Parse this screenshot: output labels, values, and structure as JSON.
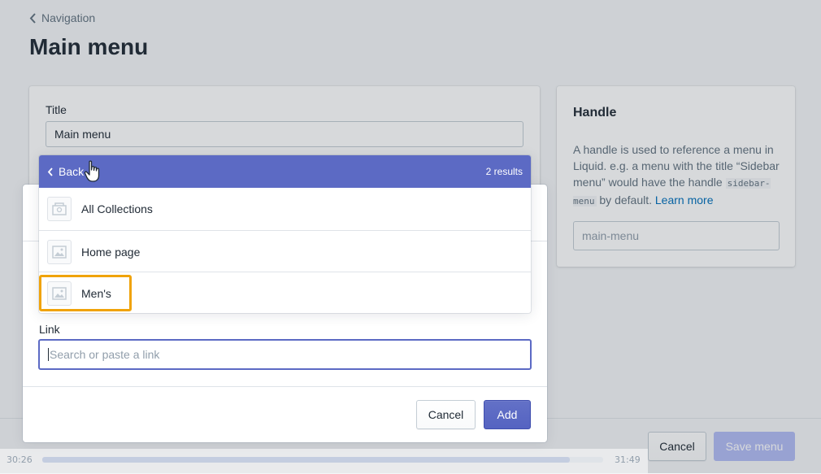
{
  "breadcrumb": {
    "label": "Navigation"
  },
  "page": {
    "title": "Main menu"
  },
  "menu_card": {
    "title_label": "Title",
    "title_value": "Main menu"
  },
  "handle_card": {
    "heading": "Handle",
    "text_1": "A handle is used to reference a menu in Liquid. e.g. a menu with the title “Sidebar menu” would have the handle ",
    "code": "sidebar-menu",
    "text_2": " by default. ",
    "learn_more": "Learn more",
    "input_value": "main-menu"
  },
  "footer": {
    "cancel_label": "Cancel",
    "save_label": "Save menu"
  },
  "popover": {
    "back_label": "Back",
    "results_text": "2 results",
    "items": [
      {
        "label": "All Collections"
      },
      {
        "label": "Home page"
      },
      {
        "label": "Men's"
      }
    ]
  },
  "modal": {
    "link_label": "Link",
    "link_placeholder": "Search or paste a link",
    "cancel_label": "Cancel",
    "add_label": "Add"
  },
  "video": {
    "time_start": "30:26",
    "time_end": "31:49",
    "progress": 0.94
  },
  "colors": {
    "accent": "#5c6ac4",
    "highlight": "#f0a30a",
    "link": "#006fbb"
  }
}
